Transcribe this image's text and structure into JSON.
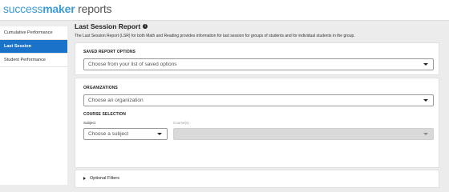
{
  "app": {
    "logo_part1": "success",
    "logo_part2": "maker",
    "logo_part3": " reports"
  },
  "sidebar": {
    "items": [
      {
        "label": "Cumulative Performance",
        "active": false
      },
      {
        "label": "Last Session",
        "active": true
      },
      {
        "label": "Student Performance",
        "active": false
      }
    ]
  },
  "page": {
    "title": "Last Session Report",
    "help_icon": "info-icon",
    "description": "The Last Session Report (LSR) for both Math and Reading provides information for last session for groups of students and for individual students in the group."
  },
  "saved_report": {
    "label": "SAVED REPORT OPTIONS",
    "placeholder": "Choose from your list of saved options"
  },
  "organizations": {
    "label": "ORGANIZATIONS",
    "placeholder": "Choose an organization"
  },
  "course_selection": {
    "label": "COURSE SELECTION",
    "subject_label": "Subject",
    "subject_placeholder": "Choose a subject",
    "courses_label": "Course(s)",
    "courses_value": ""
  },
  "optional_filters": {
    "label": "Optional Filters"
  },
  "colors": {
    "accent": "#1a73c8",
    "logo_blue": "#3a9bd5",
    "background": "#ececec"
  }
}
